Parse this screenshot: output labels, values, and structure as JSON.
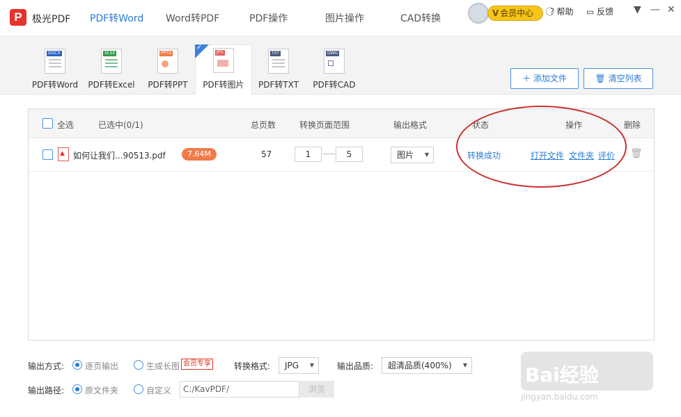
{
  "app": {
    "logo_letter": "P",
    "name": "极光PDF"
  },
  "nav": {
    "tabs": [
      "PDF转Word",
      "Word转PDF",
      "PDF操作",
      "图片操作",
      "CAD转换"
    ],
    "active_index": 0
  },
  "header": {
    "vip_label": "会员中心",
    "vip_mark": "V",
    "help_label": "帮助",
    "feedback_label": "反馈"
  },
  "tools": [
    {
      "label": "PDF转Word",
      "tag": "DOCX",
      "tag_color": "#2b63c6",
      "icon": "word-doc-icon"
    },
    {
      "label": "PDF转Excel",
      "tag": "XLSX",
      "tag_color": "#2e9b4c",
      "icon": "excel-doc-icon"
    },
    {
      "label": "PDF转PPT",
      "tag": "PPTX",
      "tag_color": "#ef7c4a",
      "icon": "ppt-doc-icon"
    },
    {
      "label": "PDF转图片",
      "tag": "JPG",
      "tag_color": "#e85a5a",
      "icon": "image-doc-icon",
      "active": true
    },
    {
      "label": "PDF转TXT",
      "tag": "TXT",
      "tag_color": "#4a5a80",
      "icon": "txt-doc-icon"
    },
    {
      "label": "PDF转CAD",
      "tag": "DWG",
      "tag_color": "#4a5a80",
      "icon": "cad-doc-icon"
    }
  ],
  "actions": {
    "add_file": "添加文件",
    "clear_list": "清空列表"
  },
  "table": {
    "headers": {
      "select_all": "全选",
      "selected": "已选中(0/1)",
      "total_pages": "总页数",
      "page_range": "转换页面范围",
      "output_format": "输出格式",
      "status": "状态",
      "actions": "操作",
      "delete": "删除"
    },
    "rows": [
      {
        "filename": "如何让我们...90513.pdf",
        "size": "7.64M",
        "pages": "57",
        "range_from": "1",
        "range_to": "5",
        "format": "图片",
        "status": "转换成功",
        "open_file": "打开文件",
        "folder": "文件夹",
        "rate": "评价"
      }
    ]
  },
  "settings": {
    "output_mode_label": "输出方式:",
    "mode_per_page": "逐页输出",
    "mode_long_image": "生成长图",
    "vip_only": "会员专享",
    "convert_format_label": "转换格式:",
    "convert_format_value": "JPG",
    "quality_label": "输出品质:",
    "quality_value": "超清品质(400%)",
    "output_path_label": "输出路径:",
    "path_original": "原文件夹",
    "path_custom": "自定义",
    "path_value": "C:/KavPDF/",
    "browse": "浏览"
  },
  "watermark": {
    "brand": "Bai经验",
    "url": "jingyan.baidu.com"
  },
  "colors": {
    "accent": "#2a7bd6",
    "brand_red": "#e8322d",
    "annotation_red": "#c9302c"
  }
}
